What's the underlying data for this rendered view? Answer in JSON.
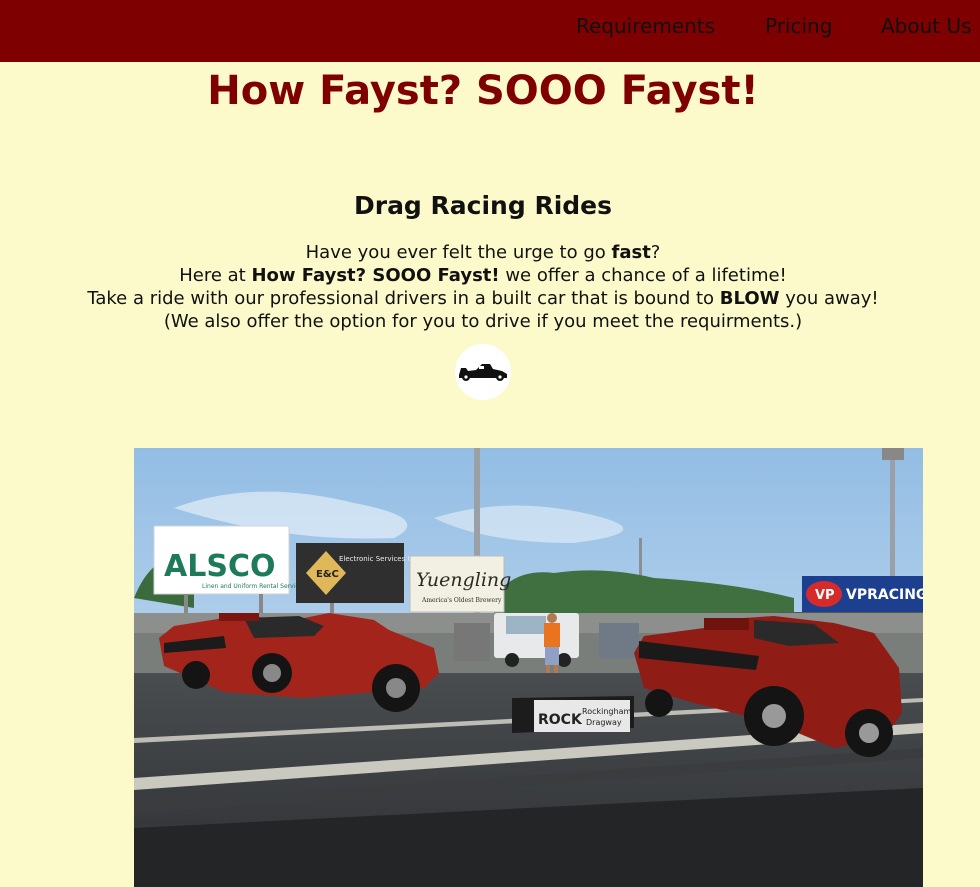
{
  "nav": {
    "requirements": "Requirements",
    "pricing": "Pricing",
    "about": "About Us"
  },
  "site_title": "How Fayst? SOOO Fayst!",
  "section_title": "Drag Racing Rides",
  "intro": {
    "line1_pre": "Have you ever felt the urge to go ",
    "line1_bold": "fast",
    "line1_post": "?",
    "line2_pre": "Here at ",
    "line2_bold": "How Fayst? SOOO Fayst!",
    "line2_post": " we offer a chance of a lifetime!",
    "line3_pre": "Take a ride with our professional drivers in a built car that is bound to ",
    "line3_bold": "BLOW",
    "line3_post": " you away!",
    "line4": "(We also offer the option for you to drive if you meet the requirments.)"
  },
  "logo_icon": "race-car-icon",
  "photo": {
    "signs": {
      "alsco": "ALSCO",
      "alsco_sub": "Linen and Uniform Rental Services",
      "ebc": "E&C",
      "ebc_title": "Electronic Services Co.",
      "yuengling": "Yuengling",
      "yuengling_sub": "America's Oldest Brewery",
      "vp": "VPRACING",
      "rock": "ROCK",
      "rockingham": "Rockingham",
      "dragway": "Dragway"
    }
  },
  "colors": {
    "background": "#fcfacb",
    "navbar": "#7f0000",
    "title": "#7f0000",
    "car": "#9d1f17"
  }
}
